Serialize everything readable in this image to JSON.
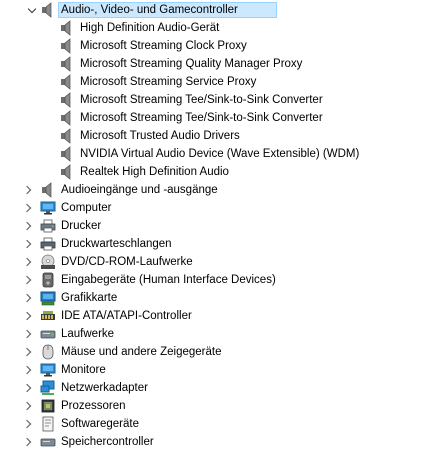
{
  "category_expanded": {
    "label": "Audio-, Video- und Gamecontroller",
    "icon": "speaker-icon",
    "children": [
      {
        "label": "High Definition Audio-Gerät",
        "icon": "speaker-icon"
      },
      {
        "label": "Microsoft Streaming Clock Proxy",
        "icon": "speaker-icon"
      },
      {
        "label": "Microsoft Streaming Quality Manager Proxy",
        "icon": "speaker-icon"
      },
      {
        "label": "Microsoft Streaming Service Proxy",
        "icon": "speaker-icon"
      },
      {
        "label": "Microsoft Streaming Tee/Sink-to-Sink Converter",
        "icon": "speaker-icon"
      },
      {
        "label": "Microsoft Streaming Tee/Sink-to-Sink Converter",
        "icon": "speaker-icon"
      },
      {
        "label": "Microsoft Trusted Audio Drivers",
        "icon": "speaker-icon"
      },
      {
        "label": "NVIDIA Virtual Audio Device (Wave Extensible) (WDM)",
        "icon": "speaker-icon"
      },
      {
        "label": "Realtek High Definition Audio",
        "icon": "speaker-icon"
      }
    ]
  },
  "categories": [
    {
      "label": "Audioeingänge und -ausgänge",
      "icon": "speaker-icon"
    },
    {
      "label": "Computer",
      "icon": "monitor-icon"
    },
    {
      "label": "Drucker",
      "icon": "printer-icon"
    },
    {
      "label": "Druckwarteschlangen",
      "icon": "printer-icon"
    },
    {
      "label": "DVD/CD-ROM-Laufwerke",
      "icon": "disc-drive-icon"
    },
    {
      "label": "Eingabegeräte (Human Interface Devices)",
      "icon": "hid-icon"
    },
    {
      "label": "Grafikkarte",
      "icon": "display-adapter-icon"
    },
    {
      "label": "IDE ATA/ATAPI-Controller",
      "icon": "ide-controller-icon"
    },
    {
      "label": "Laufwerke",
      "icon": "drive-icon"
    },
    {
      "label": "Mäuse und andere Zeigegeräte",
      "icon": "mouse-icon"
    },
    {
      "label": "Monitore",
      "icon": "monitor-icon"
    },
    {
      "label": "Netzwerkadapter",
      "icon": "network-adapter-icon"
    },
    {
      "label": "Prozessoren",
      "icon": "processor-icon"
    },
    {
      "label": "Softwaregeräte",
      "icon": "software-device-icon"
    },
    {
      "label": "Speichercontroller",
      "icon": "storage-controller-icon"
    }
  ],
  "colors": {
    "selection_fill": "#cce8ff",
    "selection_border": "#99d1ff"
  }
}
